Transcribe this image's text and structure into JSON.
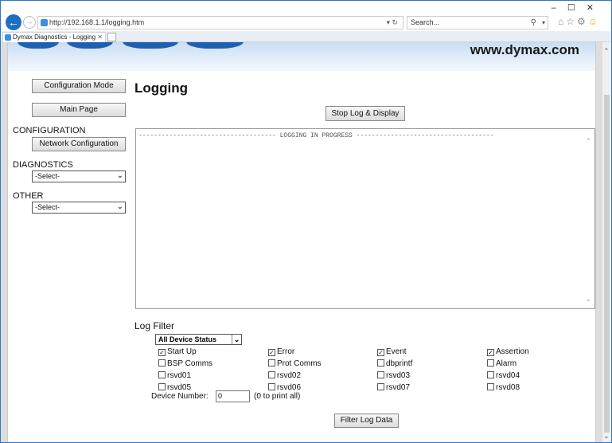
{
  "browser": {
    "url": "http://192.168.1.1/logging.htm",
    "search_placeholder": "Search...",
    "tab_title": "Dymax Diagnostics - Logging",
    "minimize": "–",
    "maximize": "☐",
    "close": "✕",
    "back": "←",
    "forward": "→",
    "addr_controls": "▾ ↻",
    "search_icon": "⚲",
    "search_dropdown": "▾",
    "tab_close": "✕",
    "icon_home": "⌂",
    "icon_star": "☆",
    "icon_gear": "⚙",
    "icon_smile": "☺"
  },
  "banner": {
    "site": "www.dymax.com"
  },
  "sidebar": {
    "config_mode_btn": "Configuration Mode",
    "main_page_btn": "Main Page",
    "configuration_heading": "CONFIGURATION",
    "network_config_btn": "Network Configuration",
    "diagnostics_heading": "DIAGNOSTICS",
    "diagnostics_select": "-Select-",
    "other_heading": "OTHER",
    "other_select": "-Select-"
  },
  "main": {
    "title": "Logging",
    "stop_btn": "Stop Log & Display",
    "log_line": "------------------------------------ LOGGING IN PROGRESS ------------------------------------",
    "filter_title": "Log Filter",
    "status_select": "All Device Status",
    "checkboxes": [
      {
        "label": "Start Up",
        "checked": true
      },
      {
        "label": "Error",
        "checked": true
      },
      {
        "label": "Event",
        "checked": true
      },
      {
        "label": "Assertion",
        "checked": true
      },
      {
        "label": "BSP Comms",
        "checked": false
      },
      {
        "label": "Prot Comms",
        "checked": false
      },
      {
        "label": "dbprintf",
        "checked": false
      },
      {
        "label": "Alarm",
        "checked": false
      },
      {
        "label": "rsvd01",
        "checked": false
      },
      {
        "label": "rsvd02",
        "checked": false
      },
      {
        "label": "rsvd03",
        "checked": false
      },
      {
        "label": "rsvd04",
        "checked": false
      },
      {
        "label": "rsvd05",
        "checked": false
      },
      {
        "label": "rsvd06",
        "checked": false
      },
      {
        "label": "rsvd07",
        "checked": false
      },
      {
        "label": "rsvd08",
        "checked": false
      }
    ],
    "device_number_label": "Device Number:",
    "device_number_value": "0",
    "device_number_hint": "(0 to print all)",
    "filter_btn": "Filter Log Data"
  }
}
